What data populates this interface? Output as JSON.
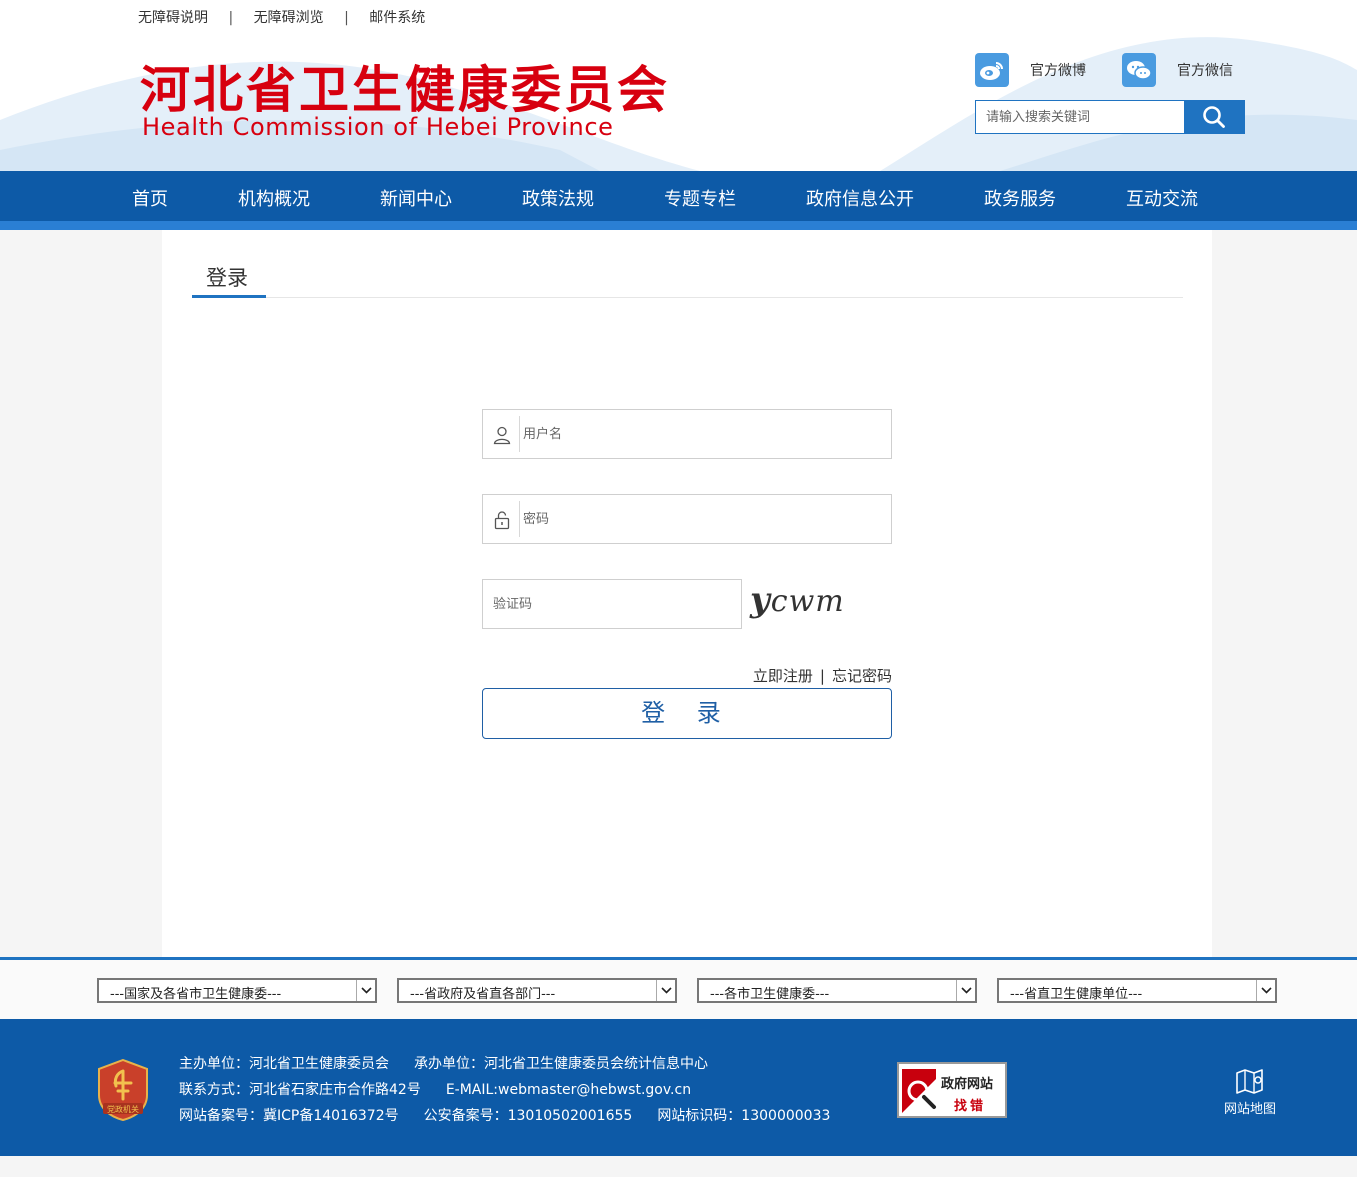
{
  "top_links": [
    "无障碍说明",
    "无障碍浏览",
    "邮件系统"
  ],
  "top_links_sep": "|",
  "logo": {
    "cn": "河北省卫生健康委员会",
    "en": "Health Commission of Hebei Province"
  },
  "social": {
    "weibo_label": "官方微博",
    "wechat_label": "官方微信"
  },
  "search": {
    "placeholder": "请输入搜索关键词"
  },
  "nav": [
    "首页",
    "机构概况",
    "新闻中心",
    "政策法规",
    "专题专栏",
    "政府信息公开",
    "政务服务",
    "互动交流"
  ],
  "login": {
    "title": "登录",
    "username_placeholder": "用户名",
    "password_placeholder": "密码",
    "captcha_placeholder": "验证码",
    "captcha_first": "y",
    "captcha_rest": "cwm",
    "register_link": "立即注册",
    "link_sep": "|",
    "forgot_link": "忘记密码",
    "submit_label": "登 录"
  },
  "selects": [
    "---国家及各省市卫生健康委---",
    "---省政府及省直各部门---",
    "---各市卫生健康委---",
    "---省直卫生健康单位---"
  ],
  "footer": {
    "badge_text": "党政机关",
    "line1_a": "主办单位：河北省卫生健康委员会",
    "line1_b": "承办单位：河北省卫生健康委员会统计信息中心",
    "line2_a": "联系方式：河北省石家庄市合作路42号",
    "line2_b": "E-MAIL:webmaster@hebwst.gov.cn",
    "line3_a": "网站备案号：冀ICP备14016372号",
    "line3_b": "公安备案号：13010502001655",
    "line3_c": "网站标识码：1300000033",
    "find_error_line1": "政府网站",
    "find_error_line2": "找错",
    "sitemap_label": "网站地图"
  },
  "colors": {
    "brand_red": "#d7000f",
    "nav_blue": "#0d5aa7",
    "accent_blue": "#1f73c1"
  }
}
